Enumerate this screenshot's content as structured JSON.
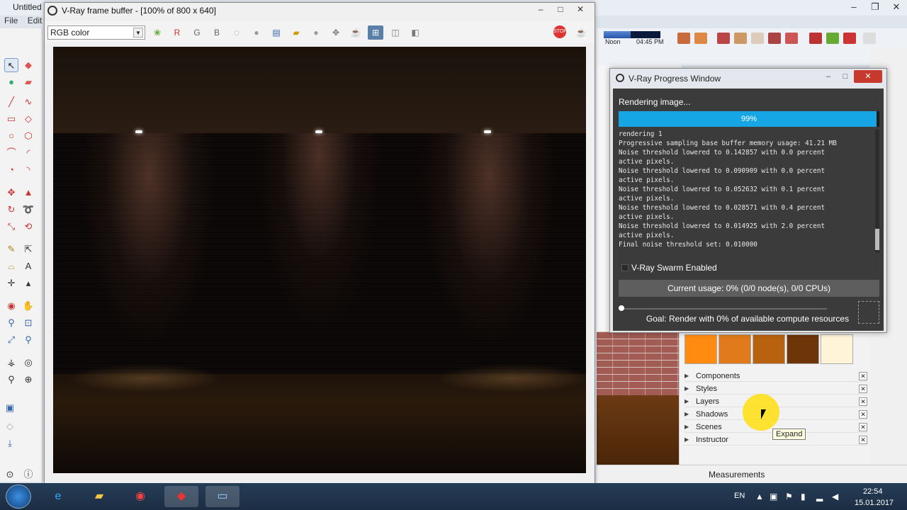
{
  "sketchup": {
    "title": "Untitled",
    "menu": [
      "File",
      "Edit"
    ],
    "window_buttons": [
      "–",
      "❐",
      "✕"
    ],
    "shadow_noon": "Noon",
    "shadow_time": "04:45 PM",
    "tray_items": [
      {
        "label": "Components"
      },
      {
        "label": "Styles"
      },
      {
        "label": "Layers"
      },
      {
        "label": "Shadows"
      },
      {
        "label": "Scenes"
      },
      {
        "label": "Instructor"
      }
    ],
    "tooltip": "Expand",
    "measurements_label": "Measurements",
    "swatch_colors": [
      "#ff8c10",
      "#e07a1a",
      "#b8610f",
      "#6e3508",
      "#fff4d8"
    ]
  },
  "vfb": {
    "title": "V-Ray frame buffer - [100% of 800 x 640]",
    "channel": "RGB color",
    "channel_letters": [
      "R",
      "G",
      "B"
    ],
    "buttons": [
      "–",
      "□",
      "✕"
    ]
  },
  "progress": {
    "title": "V-Ray Progress Window",
    "status": "Rendering image...",
    "percent_label": "99%",
    "percent": 0.99,
    "log": "rendering 1\nProgressive sampling base buffer memory usage: 41.21 MB\nNoise threshold lowered to 0.142857 with 0.0 percent\nactive pixels.\nNoise threshold lowered to 0.090909 with 0.0 percent\nactive pixels.\nNoise threshold lowered to 0.052632 with 0.1 percent\nactive pixels.\nNoise threshold lowered to 0.028571 with 0.4 percent\nactive pixels.\nNoise threshold lowered to 0.014925 with 2.0 percent\nactive pixels.\nFinal noise threshold set: 0.010000",
    "swarm_label": "V-Ray Swarm Enabled",
    "usage_label": "Current usage: 0% (0/0 node(s), 0/0 CPUs)",
    "goal_label": "Goal: Render with 0% of available compute resources",
    "accent": "#16a6e6"
  },
  "taskbar": {
    "lang": "EN",
    "time": "22:54",
    "date": "15.01.2017"
  }
}
